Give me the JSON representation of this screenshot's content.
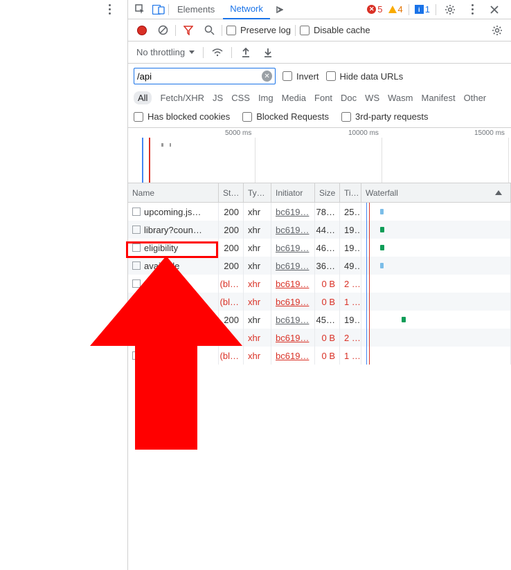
{
  "tabs": {
    "elements": "Elements",
    "network": "Network"
  },
  "status": {
    "errors": "5",
    "warnings": "4",
    "info": "1"
  },
  "toolbar": {
    "preserve": "Preserve log",
    "disable_cache": "Disable cache"
  },
  "throttle": {
    "label": "No throttling"
  },
  "filter": {
    "value": "/api",
    "invert": "Invert",
    "hide": "Hide data URLs"
  },
  "types": {
    "all": "All",
    "fetch": "Fetch/XHR",
    "js": "JS",
    "css": "CSS",
    "img": "Img",
    "media": "Media",
    "font": "Font",
    "doc": "Doc",
    "ws": "WS",
    "wasm": "Wasm",
    "manifest": "Manifest",
    "other": "Other"
  },
  "checks": {
    "bcookies": "Has blocked cookies",
    "breq": "Blocked Requests",
    "tparty": "3rd-party requests"
  },
  "timeline": {
    "t1": "5000 ms",
    "t2": "10000 ms",
    "t3": "15000 ms"
  },
  "cols": {
    "name": "Name",
    "st": "St…",
    "ty": "Ty…",
    "in": "Initiator",
    "sz": "Size",
    "ti": "Ti…",
    "wf": "Waterfall"
  },
  "rows": [
    {
      "name": "upcoming.js…",
      "status": "200",
      "type": "xhr",
      "init": "bc619…",
      "size": "78…",
      "time": "25…",
      "blocked": false
    },
    {
      "name": "library?coun…",
      "status": "200",
      "type": "xhr",
      "init": "bc619…",
      "size": "44…",
      "time": "19…",
      "blocked": false
    },
    {
      "name": "eligibility",
      "status": "200",
      "type": "xhr",
      "init": "bc619…",
      "size": "46…",
      "time": "19…",
      "blocked": false
    },
    {
      "name": "available",
      "status": "200",
      "type": "xhr",
      "init": "bc619…",
      "size": "36…",
      "time": "49…",
      "blocked": false
    },
    {
      "name": "",
      "status": "(bl…",
      "type": "xhr",
      "init": "bc619…",
      "size": "0 B",
      "time": "2 …",
      "blocked": true
    },
    {
      "name": "",
      "status": "(bl…",
      "type": "xhr",
      "init": "bc619…",
      "size": "0 B",
      "time": "1 …",
      "blocked": true
    },
    {
      "name": "",
      "status": "200",
      "type": "xhr",
      "init": "bc619…",
      "size": "45…",
      "time": "19…",
      "blocked": false
    },
    {
      "name": "",
      "status": "(bl…",
      "type": "xhr",
      "init": "bc619…",
      "size": "0 B",
      "time": "2 …",
      "blocked": true
    },
    {
      "name": "",
      "status": "(bl…",
      "type": "xhr",
      "init": "bc619…",
      "size": "0 B",
      "time": "1 …",
      "blocked": true
    }
  ]
}
